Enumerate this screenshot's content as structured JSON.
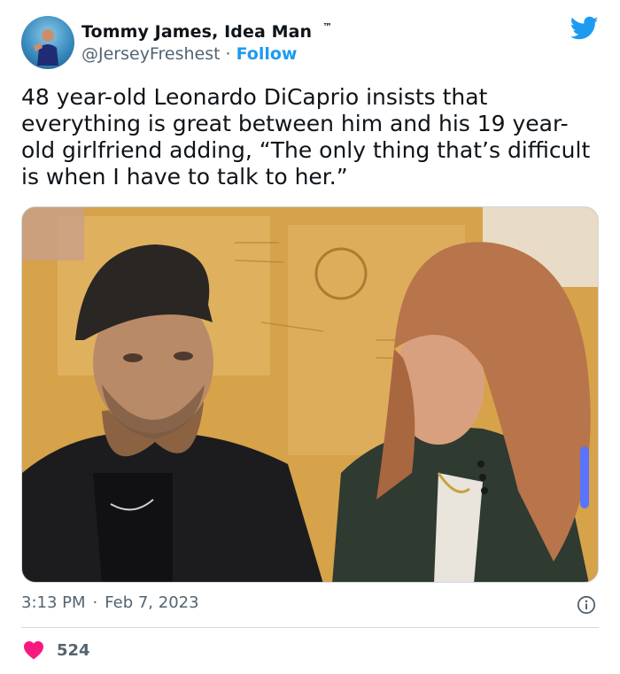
{
  "author": {
    "display_name": "Tommy James, Idea Man",
    "tm": "™",
    "handle": "@JerseyFreshest",
    "separator": "·",
    "follow_label": "Follow"
  },
  "tweet": {
    "text": "48 year-old Leonardo DiCaprio insists that\neverything is great between him and his 19 year-\nold girlfriend adding, “The only thing that’s difficult\nis when I have to talk to her.”"
  },
  "meta": {
    "time": "3:13 PM",
    "separator": "·",
    "date": "Feb 7, 2023"
  },
  "engagement": {
    "likes": "524"
  },
  "icons": {
    "brand": "twitter-bird-icon",
    "info": "info-icon",
    "like": "heart-icon"
  },
  "colors": {
    "brand_blue": "#1d9bf0",
    "like_red": "#f91880",
    "secondary_text": "#536471",
    "primary_text": "#0f1419"
  }
}
